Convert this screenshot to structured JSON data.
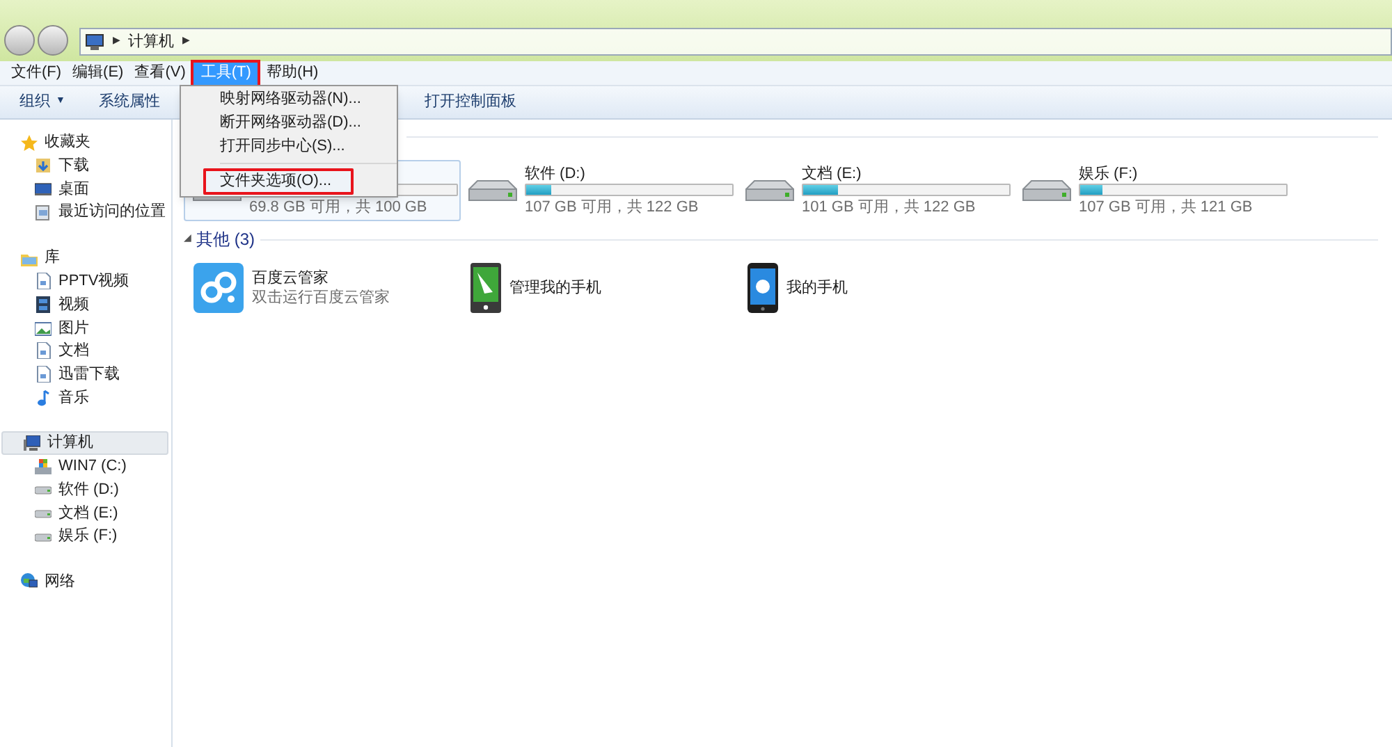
{
  "address_bar": {
    "lead_arrow": "▶",
    "segments": [
      {
        "label": "计算机",
        "arrow": "▶"
      }
    ]
  },
  "menu_bar": [
    {
      "label": "文件(F)",
      "selected": false
    },
    {
      "label": "编辑(E)",
      "selected": false
    },
    {
      "label": "查看(V)",
      "selected": false
    },
    {
      "label": "工具(T)",
      "selected": true
    },
    {
      "label": "帮助(H)",
      "selected": false
    }
  ],
  "toolbar": [
    {
      "label": "组织",
      "dropdown_arrow": "▼"
    },
    {
      "label": "系统属性"
    },
    {
      "label": "打开控制面板"
    }
  ],
  "dropdown_menu": [
    {
      "label": "映射网络驱动器(N)...",
      "highlighted": false
    },
    {
      "label": "断开网络驱动器(D)...",
      "highlighted": false
    },
    {
      "label": "打开同步中心(S)...",
      "highlighted": false
    },
    {
      "label": "文件夹选项(O)...",
      "highlighted": true
    }
  ],
  "sidebar": [
    {
      "label": "收藏夹",
      "kind": "star",
      "children": [
        {
          "label": "下载",
          "kind": "download"
        },
        {
          "label": "桌面",
          "kind": "desktop"
        },
        {
          "label": "最近访问的位置",
          "kind": "recent"
        }
      ]
    },
    {
      "label": "库",
      "kind": "library",
      "children": [
        {
          "label": "PPTV视频",
          "kind": "doc"
        },
        {
          "label": "视频",
          "kind": "video"
        },
        {
          "label": "图片",
          "kind": "picture"
        },
        {
          "label": "文档",
          "kind": "doc"
        },
        {
          "label": "迅雷下载",
          "kind": "doc"
        },
        {
          "label": "音乐",
          "kind": "music"
        }
      ]
    },
    {
      "label": "计算机",
      "kind": "computer",
      "selected": true,
      "children": [
        {
          "label": "WIN7 (C:)",
          "kind": "windrive"
        },
        {
          "label": "软件 (D:)",
          "kind": "drive"
        },
        {
          "label": "文档 (E:)",
          "kind": "drive"
        },
        {
          "label": "娱乐 (F:)",
          "kind": "drive"
        }
      ]
    },
    {
      "label": "网络",
      "kind": "network"
    }
  ],
  "drives": [
    {
      "free": "69.8 GB 可用，共 100 GB",
      "selected": true
    },
    {
      "label": "软件 (D:)",
      "level": 0.12,
      "free": "107 GB 可用，共 122 GB",
      "selected": false
    },
    {
      "label": "文档 (E:)",
      "level": 0.17,
      "free": "101 GB 可用，共 122 GB",
      "selected": false
    },
    {
      "label": "娱乐 (F:)",
      "level": 0.11,
      "free": "107 GB 可用，共 121 GB",
      "selected": false
    }
  ],
  "other_group": {
    "toggle": "◢",
    "title": "其他 (3)",
    "items": [
      {
        "name": "百度云管家",
        "subtitle": "双击运行百度云管家",
        "kind": "cloud"
      },
      {
        "name": "管理我的手机",
        "kind": "tablet"
      },
      {
        "name": "我的手机",
        "kind": "phone"
      }
    ]
  }
}
